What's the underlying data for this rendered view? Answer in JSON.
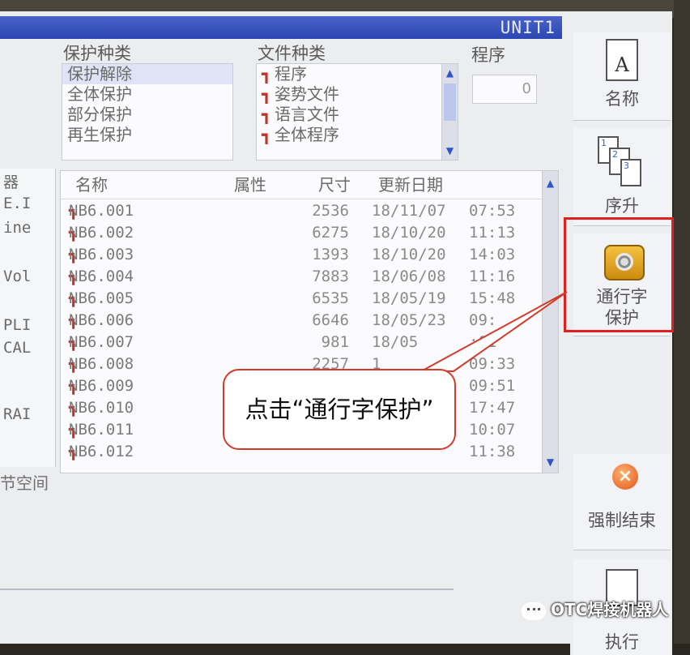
{
  "window": {
    "unit_label": "UNIT1"
  },
  "filters": {
    "protection_label": "保护种类",
    "protection_options": [
      "保护解除",
      "全体保护",
      "部分保护",
      "再生保护"
    ],
    "file_type_label": "文件种类",
    "file_type_options": [
      "程序",
      "姿势文件",
      "语言文件",
      "全体程序"
    ],
    "program_label": "程序",
    "program_value": "0"
  },
  "left_panel": {
    "lines": [
      "器",
      "E.I",
      "ine",
      "Vol",
      "PLI",
      "CAL",
      "RAI"
    ]
  },
  "table": {
    "headers": {
      "name": "名称",
      "attr": "属性",
      "size": "尺寸",
      "date": "更新日期"
    },
    "rows": [
      {
        "name": "NB6.001",
        "size": "2536",
        "date": "18/11/07",
        "time": "07:53"
      },
      {
        "name": "NB6.002",
        "size": "6275",
        "date": "18/10/20",
        "time": "11:13"
      },
      {
        "name": "NB6.003",
        "size": "1393",
        "date": "18/10/20",
        "time": "14:03"
      },
      {
        "name": "NB6.004",
        "size": "7883",
        "date": "18/06/08",
        "time": "11:16"
      },
      {
        "name": "NB6.005",
        "size": "6535",
        "date": "18/05/19",
        "time": "15:48"
      },
      {
        "name": "NB6.006",
        "size": "6646",
        "date": "18/05/23",
        "time": "09:"
      },
      {
        "name": "NB6.007",
        "size": "981",
        "date": "18/05",
        "time": ":01"
      },
      {
        "name": "NB6.008",
        "size": "2257",
        "date": "1",
        "time": "09:33"
      },
      {
        "name": "NB6.009",
        "size": "",
        "date": "",
        "time": "09:51"
      },
      {
        "name": "NB6.010",
        "size": "",
        "date": "",
        "time": "17:47"
      },
      {
        "name": "NB6.011",
        "size": "",
        "date": "",
        "time": "10:07"
      },
      {
        "name": "NB6.012",
        "size": "",
        "date": "",
        "time": "11:38"
      }
    ]
  },
  "status": {
    "free_space": "节空间"
  },
  "side": {
    "name_button": "名称",
    "sort_button": "序升",
    "protect_button_line1": "通行字",
    "protect_button_line2": "保护",
    "force_end_button": "强制结束",
    "exec_button": "执行"
  },
  "callout": {
    "text": "点击“通行字保护”"
  },
  "watermark": {
    "text": "OTC焊接机器人"
  },
  "colors": {
    "highlight": "#e02020",
    "title_bar": "#2c46b3"
  }
}
